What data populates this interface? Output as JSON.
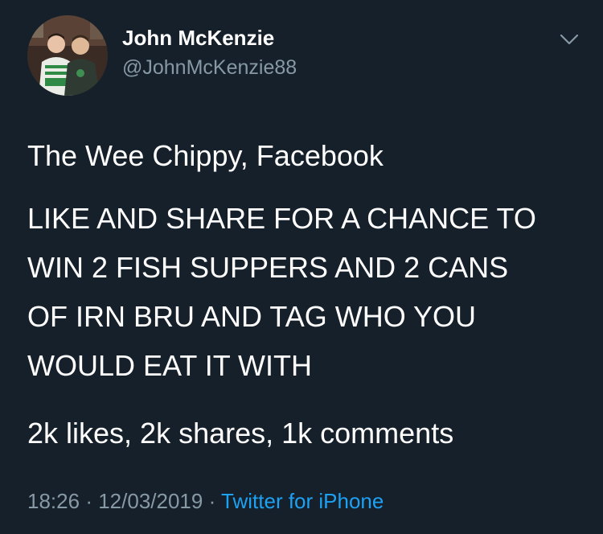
{
  "tweet": {
    "author": {
      "display_name": "John McKenzie",
      "handle": "@JohnMcKenzie88"
    },
    "menu_icon": "chevron-down-icon",
    "paragraphs": [
      [
        "The Wee Chippy, Facebook"
      ],
      [
        "LIKE AND SHARE FOR A CHANCE TO",
        "WIN 2 FISH SUPPERS AND 2 CANS",
        "OF IRN BRU AND TAG WHO YOU",
        "WOULD EAT IT WITH"
      ],
      [
        "2k likes, 2k shares, 1k comments"
      ]
    ],
    "meta": {
      "time": "18:26",
      "separator": "·",
      "date": "12/03/2019",
      "source": "Twitter for iPhone"
    }
  },
  "colors": {
    "background": "#15202b",
    "text_primary": "#ffffff",
    "text_secondary": "#8899a6",
    "link": "#1da1f2"
  }
}
